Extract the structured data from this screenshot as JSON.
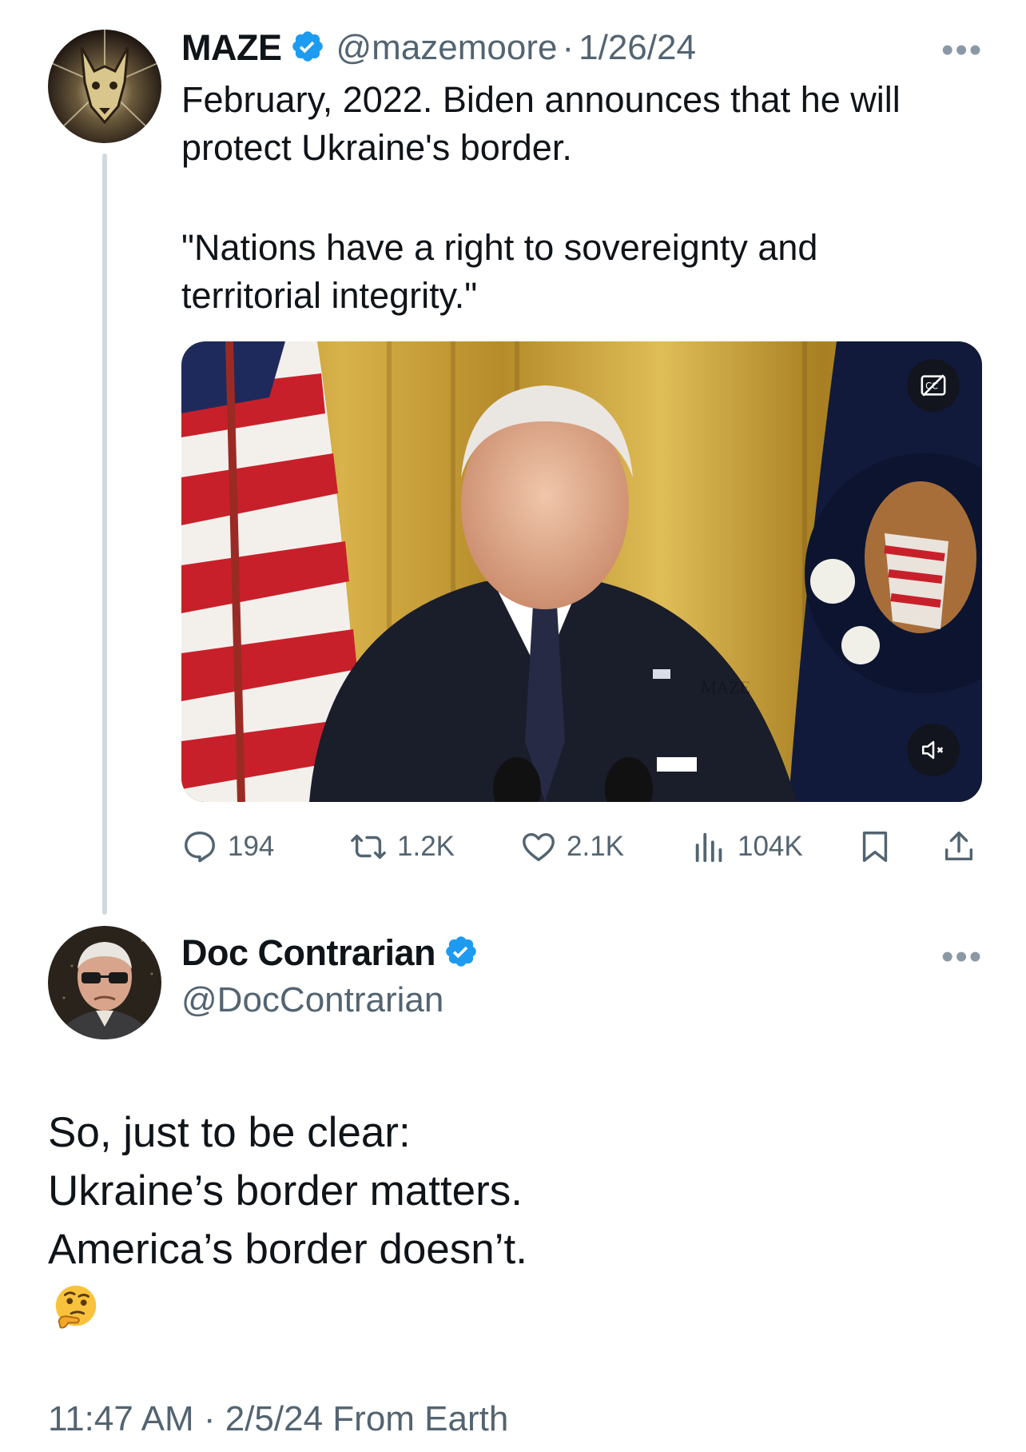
{
  "colors": {
    "verified": "#1d9bf0",
    "muted": "#536471",
    "thread_line": "#cfd9de"
  },
  "tweet": {
    "author": {
      "name": "MAZE",
      "handle": "@mazemoore",
      "verified": true,
      "avatar": "doberman-dog-logo"
    },
    "separator": "·",
    "date": "1/26/24",
    "more": "•••",
    "text_p1": "February, 2022. Biden announces that he will\nprotect Ukraine's border.",
    "text_p2": "\"Nations have a right to sovereignty and\nterritorial integrity.\"",
    "media": {
      "type": "video",
      "watermark": "MAZE",
      "captions_icon": "cc-off-icon",
      "mute_icon": "muted-speaker-icon"
    },
    "actions": {
      "replies": "194",
      "reposts": "1.2K",
      "likes": "2.1K",
      "views": "104K"
    }
  },
  "reply": {
    "author": {
      "name": "Doc Contrarian",
      "handle": "@DocContrarian",
      "verified": true,
      "avatar": "older-man-portrait"
    },
    "more": "•••",
    "text": "So, just to be clear:\nUkraine’s border matters.\nAmerica’s border doesn’t.",
    "emoji": "🤔",
    "footer": "11:47 AM · 2/5/24 From Earth"
  }
}
